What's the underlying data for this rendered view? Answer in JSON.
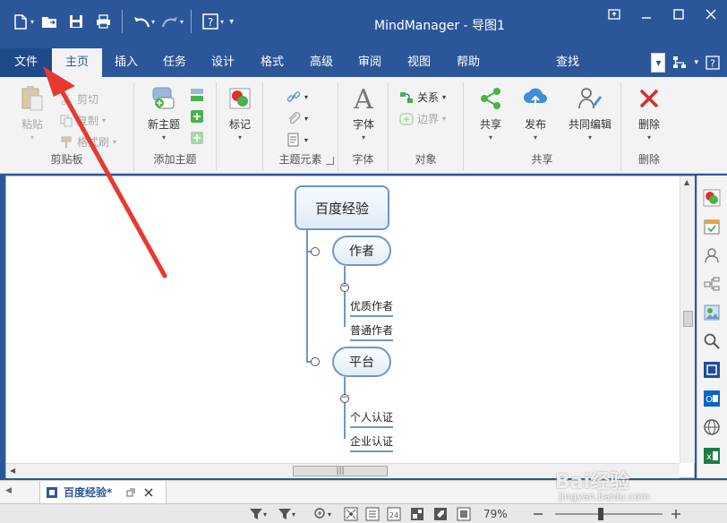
{
  "app": {
    "title": "MindManager - 导图1"
  },
  "tabs": [
    {
      "label": "文件"
    },
    {
      "label": "主页"
    },
    {
      "label": "插入"
    },
    {
      "label": "任务"
    },
    {
      "label": "设计"
    },
    {
      "label": "格式"
    },
    {
      "label": "高级"
    },
    {
      "label": "审阅"
    },
    {
      "label": "视图"
    },
    {
      "label": "帮助"
    },
    {
      "label": "查找"
    }
  ],
  "ribbon": {
    "clipboard": {
      "label": "剪贴板",
      "paste": "粘贴",
      "cut": "剪切",
      "copy": "复制",
      "format_painter": "格式刷"
    },
    "add_topic": {
      "label": "添加主题",
      "new_topic": "新主题"
    },
    "markers": {
      "mark": "标记"
    },
    "topic_elements": {
      "label": "主题元素"
    },
    "font": {
      "label": "字体",
      "font": "字体"
    },
    "objects": {
      "label": "对象",
      "relation": "关系",
      "boundary": "边界"
    },
    "share": {
      "label": "共享",
      "share": "共享",
      "publish": "发布",
      "coedit": "共同编辑"
    },
    "delete": {
      "label": "删除",
      "delete": "删除"
    }
  },
  "map": {
    "central": "百度经验",
    "branches": [
      {
        "label": "作者",
        "children": [
          "优质作者",
          "普通作者"
        ]
      },
      {
        "label": "平台",
        "children": [
          "个人认证",
          "企业认证"
        ]
      }
    ]
  },
  "doc_tab": {
    "label": "百度经验*"
  },
  "status": {
    "zoom": "79%"
  },
  "watermark": {
    "brand": "Bai经验",
    "url": "jingyan.baidu.com"
  },
  "colors": {
    "brand": "#2b579a",
    "arrow": "#e8382f",
    "topic_border": "#6d97c8"
  }
}
